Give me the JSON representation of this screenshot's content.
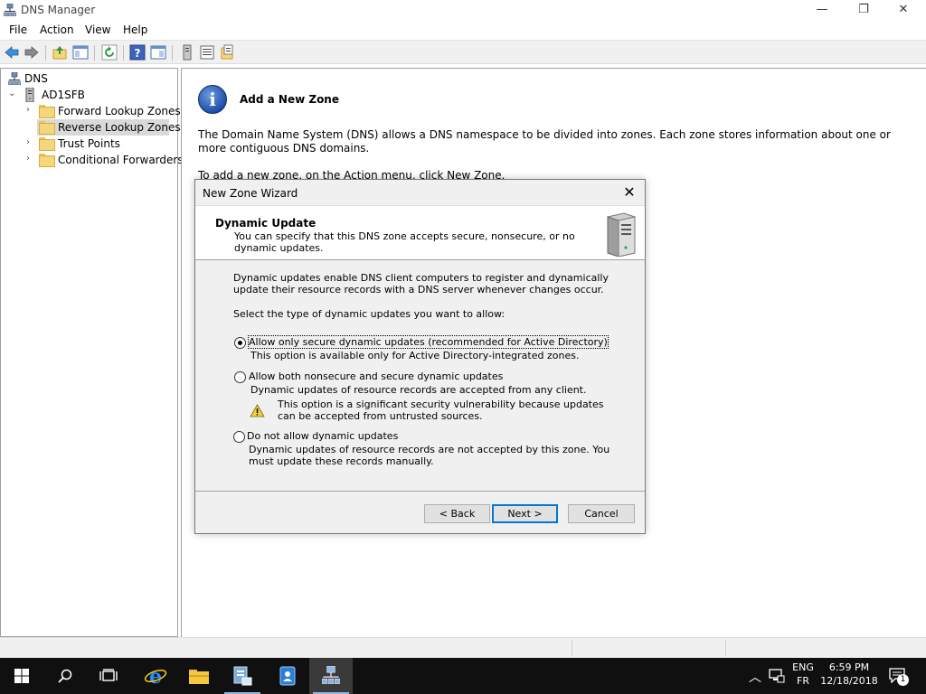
{
  "window": {
    "title": "DNS Manager",
    "minimize_glyph": "—",
    "maximize_glyph": "❐",
    "close_glyph": "✕"
  },
  "menu": {
    "items": [
      "File",
      "Action",
      "View",
      "Help"
    ]
  },
  "tree": {
    "root": "DNS",
    "server": "AD1SFB",
    "children": [
      "Forward Lookup Zones",
      "Reverse Lookup Zones",
      "Trust Points",
      "Conditional Forwarders"
    ],
    "selected": "Reverse Lookup Zones"
  },
  "right_pane": {
    "title": "Add a New Zone",
    "description": "The Domain Name System (DNS) allows a DNS namespace to be divided into zones. Each zone stores information about one or more contiguous DNS domains.",
    "instruction": "To add a new zone, on the Action menu, click New Zone."
  },
  "dialog": {
    "title": "New Zone Wizard",
    "header_title": "Dynamic Update",
    "header_subtitle": "You can specify that this DNS zone accepts secure, nonsecure, or no dynamic updates.",
    "body_description": "Dynamic updates enable DNS client computers to register and dynamically update their resource records with a DNS server whenever changes occur.",
    "prompt": "Select the type of dynamic updates you want to allow:",
    "options": [
      {
        "label": "Allow only secure dynamic updates (recommended for Active Directory)",
        "description": "This option is available only for Active Directory-integrated zones.",
        "checked": true
      },
      {
        "label": "Allow both nonsecure and secure dynamic updates",
        "description": "Dynamic updates of resource records are accepted from any client.",
        "warning": "This option is a significant security vulnerability because updates can be accepted from untrusted sources.",
        "checked": false
      },
      {
        "label": "Do not allow dynamic updates",
        "description": "Dynamic updates of resource records are not accepted by this zone. You must update these records manually.",
        "checked": false
      }
    ],
    "buttons": {
      "back": "< Back",
      "next": "Next >",
      "cancel": "Cancel"
    }
  },
  "taskbar": {
    "lang_top": "ENG",
    "lang_bottom": "FR",
    "time": "6:59 PM",
    "date": "12/18/2018",
    "notification_count": "1"
  },
  "colors": {
    "accent": "#0078d7",
    "taskbar": "#101010",
    "selection": "#d9d9d9"
  }
}
